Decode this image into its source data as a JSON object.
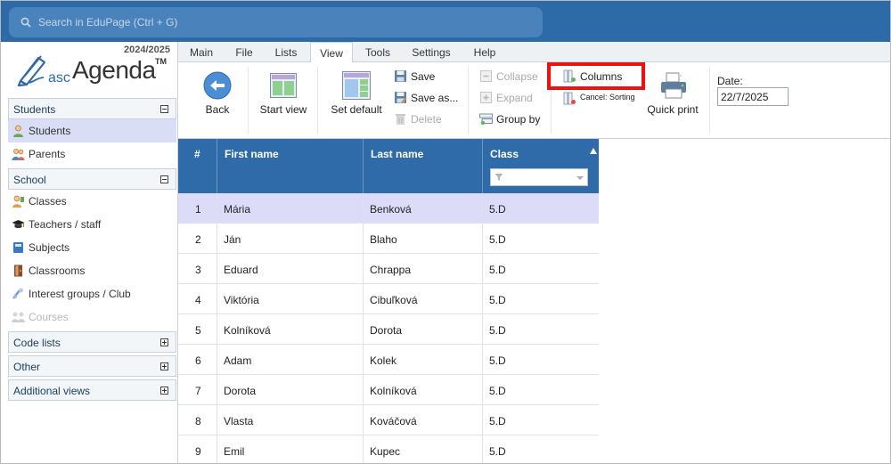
{
  "search": {
    "placeholder": "Search in EduPage (Ctrl + G)"
  },
  "brand": {
    "year": "2024/2025",
    "prefix": "asc",
    "name": "Agenda",
    "tm": "TM"
  },
  "sidebar": {
    "sections": [
      {
        "label": "Students",
        "expanded": true
      },
      {
        "label": "School",
        "expanded": true
      },
      {
        "label": "Code lists",
        "expanded": false
      },
      {
        "label": "Other",
        "expanded": false
      },
      {
        "label": "Additional views",
        "expanded": false
      }
    ],
    "students_items": [
      {
        "label": "Students",
        "icon": "student-icon",
        "active": true
      },
      {
        "label": "Parents",
        "icon": "parents-icon"
      }
    ],
    "school_items": [
      {
        "label": "Classes",
        "icon": "classes-icon"
      },
      {
        "label": "Teachers / staff",
        "icon": "graduation-cap-icon"
      },
      {
        "label": "Subjects",
        "icon": "book-icon"
      },
      {
        "label": "Classrooms",
        "icon": "door-icon"
      },
      {
        "label": "Interest groups / Club",
        "icon": "interest-groups-icon"
      },
      {
        "label": "Courses",
        "icon": "courses-icon",
        "disabled": true
      }
    ]
  },
  "tabs": [
    "Main",
    "File",
    "Lists",
    "View",
    "Tools",
    "Settings",
    "Help"
  ],
  "active_tab": "View",
  "ribbon": {
    "back": "Back",
    "start_view": "Start view",
    "set_default": "Set default",
    "save": "Save",
    "save_as": "Save as...",
    "delete": "Delete",
    "collapse": "Collapse",
    "expand": "Expand",
    "group_by": "Group by",
    "columns": "Columns",
    "cancel_sorting": "Cancel: Sorting",
    "quick_print": "Quick print",
    "date_label": "Date:",
    "date_value": "22/7/2025"
  },
  "grid": {
    "columns": [
      "#",
      "First name",
      "Last name",
      "Class"
    ],
    "rows": [
      {
        "n": "1",
        "first": "Mária",
        "last": "Benková",
        "class": "5.D",
        "selected": true
      },
      {
        "n": "2",
        "first": "Ján",
        "last": "Blaho",
        "class": "5.D"
      },
      {
        "n": "3",
        "first": "Eduard",
        "last": "Chrappa",
        "class": "5.D"
      },
      {
        "n": "4",
        "first": "Viktória",
        "last": "Cibuľková",
        "class": "5.D"
      },
      {
        "n": "5",
        "first": "Kolníková",
        "last": "Dorota",
        "class": "5.D"
      },
      {
        "n": "6",
        "first": "Adam",
        "last": "Kolek",
        "class": "5.D"
      },
      {
        "n": "7",
        "first": "Dorota",
        "last": "Kolníková",
        "class": "5.D"
      },
      {
        "n": "8",
        "first": "Vlasta",
        "last": "Kováčová",
        "class": "5.D"
      },
      {
        "n": "9",
        "first": "Emil",
        "last": "Kupec",
        "class": "5.D"
      }
    ]
  },
  "colors": {
    "topbar": "#2c6aa8",
    "grid_header": "#2f6ba9",
    "selected_row": "#dcdcf8",
    "highlight": "#ee1111"
  }
}
